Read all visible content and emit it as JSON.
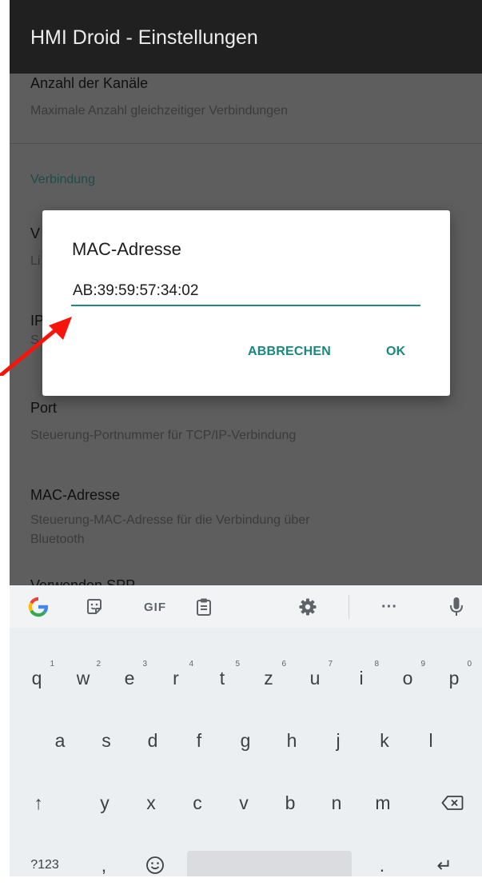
{
  "app_bar": {
    "title": "HMI Droid - Einstellungen"
  },
  "settings": {
    "channels": {
      "title": "Anzahl der Kanäle",
      "summary": "Maximale Anzahl gleichzeitiger Verbindungen"
    },
    "category": "Verbindung",
    "partial_items": [
      {
        "title": "V",
        "summary": "Li"
      },
      {
        "title": "IP",
        "summary": "S"
      }
    ],
    "port": {
      "title": "Port",
      "summary": "Steuerung-Portnummer für TCP/IP-Verbindung"
    },
    "mac": {
      "title": "MAC-Adresse",
      "summary_line1": "Steuerung-MAC-Adresse für die Verbindung über",
      "summary_line2": "Bluetooth"
    },
    "spp": {
      "title": "Verwenden SPP"
    }
  },
  "dialog": {
    "title": "MAC-Adresse",
    "value": "AB:39:59:57:34:02",
    "cancel_label": "ABBRECHEN",
    "ok_label": "OK"
  },
  "keyboard": {
    "toolbar_icons": [
      "google-icon",
      "sticker-icon",
      "gif-button",
      "clipboard-icon",
      "settings-icon",
      "more-icon",
      "microphone-icon"
    ],
    "gif_label": "GIF",
    "more_label": "···",
    "row1": [
      "q",
      "w",
      "e",
      "r",
      "t",
      "z",
      "u",
      "i",
      "o",
      "p"
    ],
    "row1_hints": [
      "1",
      "2",
      "3",
      "4",
      "5",
      "6",
      "7",
      "8",
      "9",
      "0"
    ],
    "row2": [
      "a",
      "s",
      "d",
      "f",
      "g",
      "h",
      "j",
      "k",
      "l"
    ],
    "row3": [
      "y",
      "x",
      "c",
      "v",
      "b",
      "n",
      "m"
    ],
    "symbols_label": "?123",
    "comma_label": ",",
    "period_label": ".",
    "shift_glyph": "↑",
    "enter_glyph": "↵"
  },
  "colors": {
    "accent": "#19877c",
    "app_bar": "#202020",
    "scrim_bg": "#5e5e5e",
    "keyboard_bg": "#eceff1",
    "arrow": "#f5150b"
  }
}
